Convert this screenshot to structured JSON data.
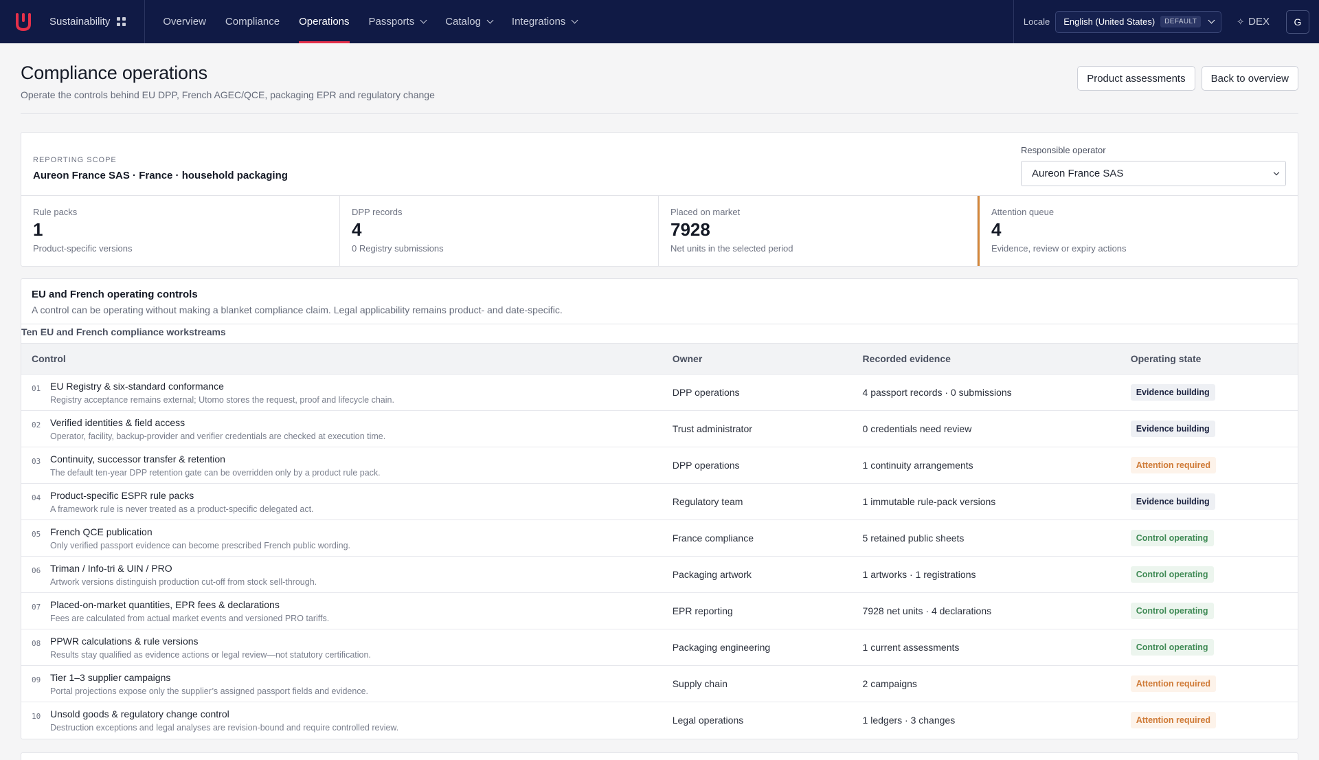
{
  "app": {
    "section_name": "Sustainability",
    "nav": [
      {
        "label": "Overview",
        "active": false,
        "has_menu": false
      },
      {
        "label": "Compliance",
        "active": false,
        "has_menu": false
      },
      {
        "label": "Operations",
        "active": true,
        "has_menu": false
      },
      {
        "label": "Passports",
        "active": false,
        "has_menu": true
      },
      {
        "label": "Catalog",
        "active": false,
        "has_menu": true
      },
      {
        "label": "Integrations",
        "active": false,
        "has_menu": true
      }
    ],
    "locale_label": "Locale",
    "locale_value": "English (United States)",
    "locale_badge": "DEFAULT",
    "dex_label": "DEX",
    "avatar_initial": "G",
    "accent_color": "#e5304a",
    "nav_bg": "#101a45"
  },
  "page": {
    "title": "Compliance operations",
    "subtitle": "Operate the controls behind EU DPP, French AGEC/QCE, packaging EPR and regulatory change",
    "actions": {
      "assessments": "Product assessments",
      "back": "Back to overview"
    }
  },
  "scope": {
    "label": "REPORTING SCOPE",
    "value": "Aureon France SAS · France · household packaging",
    "operator_label": "Responsible operator",
    "operator_value": "Aureon France SAS"
  },
  "stats": [
    {
      "label": "Rule packs",
      "value": "1",
      "sub": "Product-specific versions"
    },
    {
      "label": "DPP records",
      "value": "4",
      "sub": "0 Registry submissions"
    },
    {
      "label": "Placed on market",
      "value": "7928",
      "sub": "Net units in the selected period"
    },
    {
      "label": "Attention queue",
      "value": "4",
      "sub": "Evidence, review or expiry actions"
    }
  ],
  "controls": {
    "title": "EU and French operating controls",
    "subtitle": "A control can be operating without making a blanket compliance claim. Legal applicability remains product- and date-specific.",
    "caption": "Ten EU and French compliance workstreams",
    "columns": [
      "Control",
      "Owner",
      "Recorded evidence",
      "Operating state"
    ],
    "rows": [
      {
        "num": "01",
        "name": "EU Registry & six-standard conformance",
        "desc": "Registry acceptance remains external; Utomo stores the request, proof and lifecycle chain.",
        "owner": "DPP operations",
        "evidence": "4 passport records · 0 submissions",
        "state": "Evidence building",
        "state_kind": "building"
      },
      {
        "num": "02",
        "name": "Verified identities & field access",
        "desc": "Operator, facility, backup-provider and verifier credentials are checked at execution time.",
        "owner": "Trust administrator",
        "evidence": "0 credentials need review",
        "state": "Evidence building",
        "state_kind": "building"
      },
      {
        "num": "03",
        "name": "Continuity, successor transfer & retention",
        "desc": "The default ten-year DPP retention gate can be overridden only by a product rule pack.",
        "owner": "DPP operations",
        "evidence": "1 continuity arrangements",
        "state": "Attention required",
        "state_kind": "attention"
      },
      {
        "num": "04",
        "name": "Product-specific ESPR rule packs",
        "desc": "A framework rule is never treated as a product-specific delegated act.",
        "owner": "Regulatory team",
        "evidence": "1 immutable rule-pack versions",
        "state": "Evidence building",
        "state_kind": "building"
      },
      {
        "num": "05",
        "name": "French QCE publication",
        "desc": "Only verified passport evidence can become prescribed French public wording.",
        "owner": "France compliance",
        "evidence": "5 retained public sheets",
        "state": "Control operating",
        "state_kind": "operating"
      },
      {
        "num": "06",
        "name": "Triman / Info-tri & UIN / PRO",
        "desc": "Artwork versions distinguish production cut-off from stock sell-through.",
        "owner": "Packaging artwork",
        "evidence": "1 artworks · 1 registrations",
        "state": "Control operating",
        "state_kind": "operating"
      },
      {
        "num": "07",
        "name": "Placed-on-market quantities, EPR fees & declarations",
        "desc": "Fees are calculated from actual market events and versioned PRO tariffs.",
        "owner": "EPR reporting",
        "evidence": "7928 net units · 4 declarations",
        "state": "Control operating",
        "state_kind": "operating"
      },
      {
        "num": "08",
        "name": "PPWR calculations & rule versions",
        "desc": "Results stay qualified as evidence actions or legal review—not statutory certification.",
        "owner": "Packaging engineering",
        "evidence": "1 current assessments",
        "state": "Control operating",
        "state_kind": "operating"
      },
      {
        "num": "09",
        "name": "Tier 1–3 supplier campaigns",
        "desc": "Portal projections expose only the supplier’s assigned passport fields and evidence.",
        "owner": "Supply chain",
        "evidence": "2 campaigns",
        "state": "Attention required",
        "state_kind": "attention"
      },
      {
        "num": "10",
        "name": "Unsold goods & regulatory change control",
        "desc": "Destruction exceptions and legal analyses are revision-bound and require controlled review.",
        "owner": "Legal operations",
        "evidence": "1 ledgers · 3 changes",
        "state": "Attention required",
        "state_kind": "attention"
      }
    ]
  }
}
